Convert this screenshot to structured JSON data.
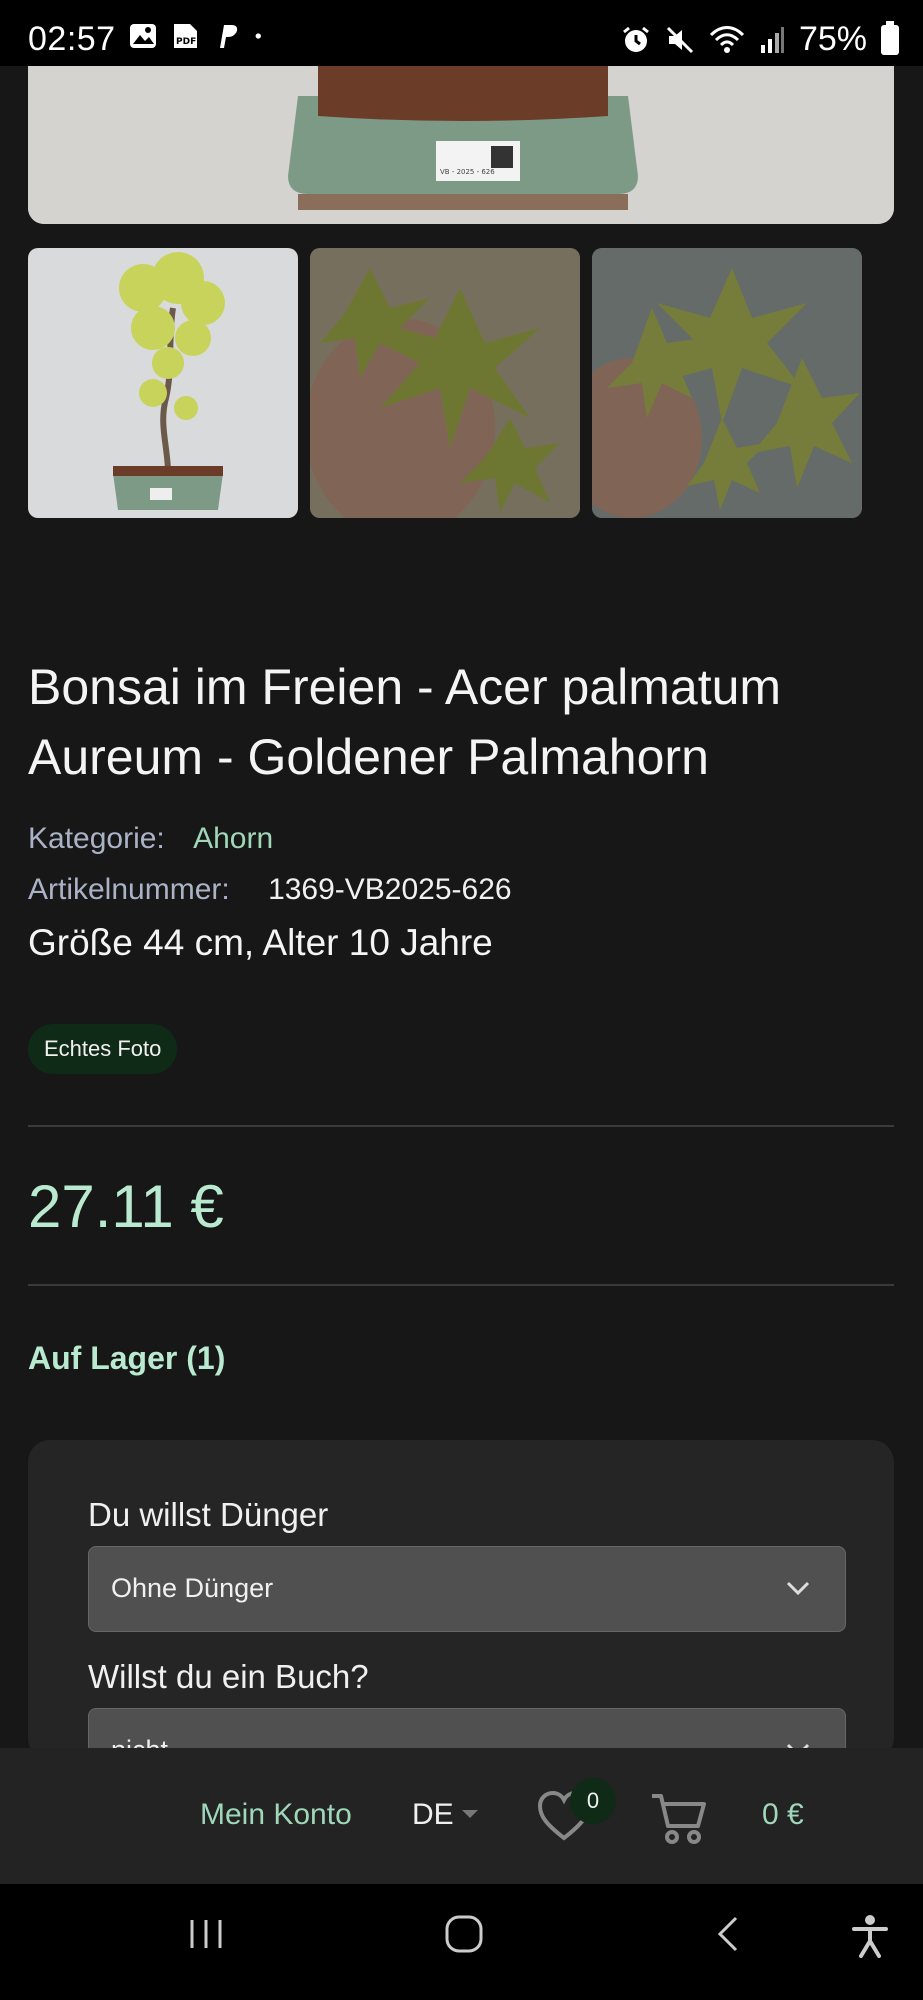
{
  "status_bar": {
    "time": "02:57",
    "battery": "75%",
    "left_icons": [
      "gallery-icon",
      "pdf-icon",
      "paypal-icon",
      "dot-icon"
    ],
    "right_icons": [
      "alarm-icon",
      "mute-icon",
      "wifi-icon",
      "signal-icon",
      "battery-icon"
    ]
  },
  "product": {
    "title": "Bonsai im Freien - Acer palmatum Aureum - Goldener Palmahorn",
    "category_label": "Kategorie:",
    "category_value": "Ahorn",
    "sku_label": "Artikelnummer:",
    "sku_value": "1369-VB2025-626",
    "size_line": "Größe 44 cm, Alter 10 Jahre",
    "badge": "Echtes Foto",
    "price": "27.11 €",
    "stock": "Auf Lager (1)",
    "pot_label_text": "VB - 2025 - 626"
  },
  "gallery": {
    "thumbnails": [
      "bonsai-tree-thumbnail",
      "leaves-in-hand-thumbnail",
      "leaves-closeup-thumbnail"
    ]
  },
  "options": {
    "fertilizer_label": "Du willst Dünger",
    "fertilizer_value": "Ohne Dünger",
    "book_label": "Willst du ein Buch?",
    "book_value": "nicht"
  },
  "bottom_bar": {
    "account": "Mein Konto",
    "language": "DE",
    "wishlist_count": "0",
    "cart_total": "0 €"
  },
  "colors": {
    "background": "#171717",
    "accent": "#9fd7b8",
    "price": "#b9ead0",
    "badge_bg": "#0f2a17"
  }
}
